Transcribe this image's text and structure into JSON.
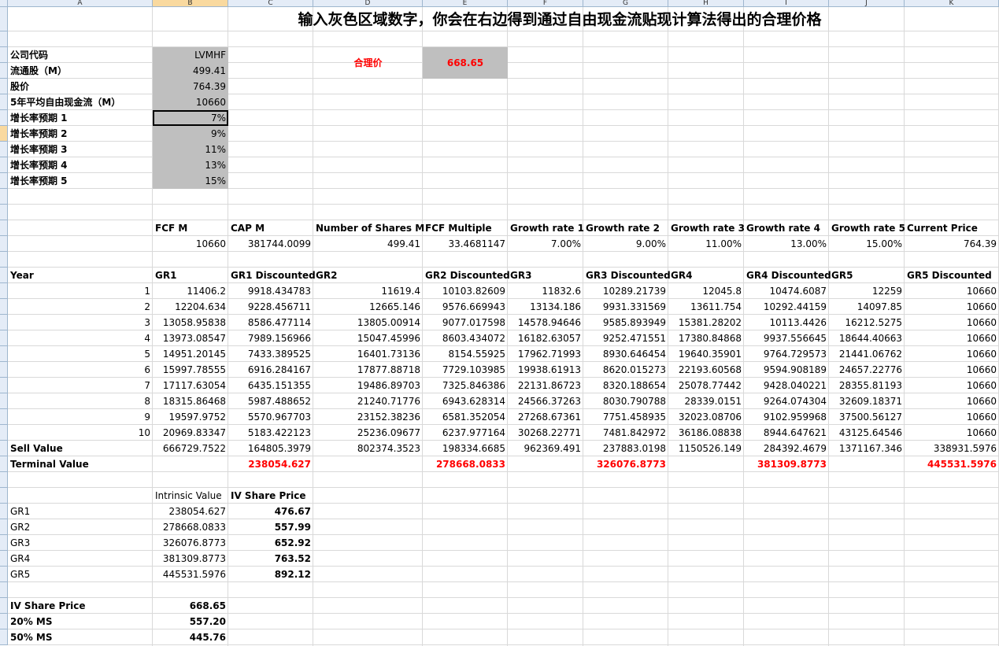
{
  "columns": [
    "A",
    "B",
    "C",
    "D",
    "E",
    "F",
    "G",
    "H",
    "I",
    "J",
    "K"
  ],
  "selected_column": "B",
  "selected_row_index": 7,
  "title": "输入灰色区域数字，你会在右边得到通过自由现金流贴现计算法得出的合理价格",
  "inputs": [
    {
      "label": "公司代码",
      "value": "LVMHF"
    },
    {
      "label": "流通股（M）",
      "value": "499.41"
    },
    {
      "label": "股价",
      "value": "764.39"
    },
    {
      "label": "5年平均自由现金流（M）",
      "value": "10660"
    },
    {
      "label": "增长率预期 1",
      "value": "7%"
    },
    {
      "label": "增长率预期 2",
      "value": "9%"
    },
    {
      "label": "增长率预期 3",
      "value": "11%"
    },
    {
      "label": "增长率预期 4",
      "value": "13%"
    },
    {
      "label": "增长率预期 5",
      "value": "15%"
    }
  ],
  "fair_price_label": "合理价",
  "fair_price_value": "668.65",
  "summary_headers": [
    "FCF M",
    "CAP M",
    "Number of Shares M",
    "FCF Multiple",
    "Growth rate 1",
    "Growth rate 2",
    "Growth rate 3",
    "Growth rate 4",
    "Growth rate 5",
    "Current Price"
  ],
  "summary_values": [
    "10660",
    "381744.0099",
    "499.41",
    "33.4681147",
    "7.00%",
    "9.00%",
    "11.00%",
    "13.00%",
    "15.00%",
    "764.39"
  ],
  "table_headers": [
    "Year",
    "GR1",
    "GR1 Discounted",
    "GR2",
    "GR2 Discounted",
    "GR3",
    "GR3 Discounted",
    "GR4",
    "GR4 Discounted",
    "GR5",
    "GR5 Discounted"
  ],
  "table_rows": [
    [
      "1",
      "11406.2",
      "9918.434783",
      "11619.4",
      "10103.82609",
      "11832.6",
      "10289.21739",
      "12045.8",
      "10474.6087",
      "12259",
      "10660"
    ],
    [
      "2",
      "12204.634",
      "9228.456711",
      "12665.146",
      "9576.669943",
      "13134.186",
      "9931.331569",
      "13611.754",
      "10292.44159",
      "14097.85",
      "10660"
    ],
    [
      "3",
      "13058.95838",
      "8586.477114",
      "13805.00914",
      "9077.017598",
      "14578.94646",
      "9585.893949",
      "15381.28202",
      "10113.4426",
      "16212.5275",
      "10660"
    ],
    [
      "4",
      "13973.08547",
      "7989.156966",
      "15047.45996",
      "8603.434072",
      "16182.63057",
      "9252.471551",
      "17380.84868",
      "9937.556645",
      "18644.40663",
      "10660"
    ],
    [
      "5",
      "14951.20145",
      "7433.389525",
      "16401.73136",
      "8154.55925",
      "17962.71993",
      "8930.646454",
      "19640.35901",
      "9764.729573",
      "21441.06762",
      "10660"
    ],
    [
      "6",
      "15997.78555",
      "6916.284167",
      "17877.88718",
      "7729.103985",
      "19938.61913",
      "8620.015273",
      "22193.60568",
      "9594.908189",
      "24657.22776",
      "10660"
    ],
    [
      "7",
      "17117.63054",
      "6435.151355",
      "19486.89703",
      "7325.846386",
      "22131.86723",
      "8320.188654",
      "25078.77442",
      "9428.040221",
      "28355.81193",
      "10660"
    ],
    [
      "8",
      "18315.86468",
      "5987.488652",
      "21240.71776",
      "6943.628314",
      "24566.37263",
      "8030.790788",
      "28339.0151",
      "9264.074304",
      "32609.18371",
      "10660"
    ],
    [
      "9",
      "19597.9752",
      "5570.967703",
      "23152.38236",
      "6581.352054",
      "27268.67361",
      "7751.458935",
      "32023.08706",
      "9102.959968",
      "37500.56127",
      "10660"
    ],
    [
      "10",
      "20969.83347",
      "5183.422123",
      "25236.09677",
      "6237.977164",
      "30268.22771",
      "7481.842972",
      "36186.08838",
      "8944.647621",
      "43125.64546",
      "10660"
    ]
  ],
  "sell_value_label": "Sell Value",
  "sell_values": [
    "666729.7522",
    "164805.3979",
    "802374.3523",
    "198334.6685",
    "962369.491",
    "237883.0198",
    "1150526.149",
    "284392.4679",
    "1371167.346",
    "338931.5976"
  ],
  "terminal_value_label": "Terminal Value",
  "terminal_values": [
    "238054.627",
    "",
    "278668.0833",
    "",
    "326076.8773",
    "",
    "381309.8773",
    "",
    "445531.5976"
  ],
  "iv_headers": [
    "Intrinsic Value",
    "IV Share Price"
  ],
  "iv_rows": [
    [
      "GR1",
      "238054.627",
      "476.67"
    ],
    [
      "GR2",
      "278668.0833",
      "557.99"
    ],
    [
      "GR3",
      "326076.8773",
      "652.92"
    ],
    [
      "GR4",
      "381309.8773",
      "763.52"
    ],
    [
      "GR5",
      "445531.5976",
      "892.12"
    ]
  ],
  "final_rows": [
    [
      "IV Share Price",
      "668.65"
    ],
    [
      "20% MS",
      "557.20"
    ],
    [
      "50% MS",
      "445.76"
    ]
  ],
  "colors": {
    "input_gray": "#bfbfbf",
    "highlight_red": "#ff0000",
    "header_bg": "#e4ecf7",
    "header_selected": "#f9d99f",
    "grid": "#d9d9d9"
  }
}
